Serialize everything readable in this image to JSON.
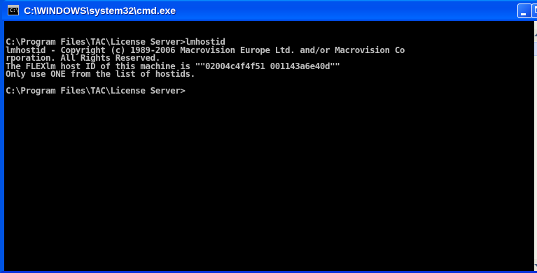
{
  "window": {
    "title": "C:\\WINDOWS\\system32\\cmd.exe",
    "icon": "cmd-console-icon",
    "icon_glyph": "C:\\",
    "accent_color": "#0054e3"
  },
  "console": {
    "background": "#000000",
    "foreground": "#c0c0c0",
    "lines": [
      "C:\\Program Files\\TAC\\License Server>lmhostid",
      "lmhostid - Copyright (c) 1989-2006 Macrovision Europe Ltd. and/or Macrovision Co",
      "rporation. All Rights Reserved.",
      "The FLEXlm host ID of this machine is \"\"02004c4f4f51 001143a6e40d\"\"",
      "Only use ONE from the list of hostids.",
      "",
      "C:\\Program Files\\TAC\\License Server>"
    ]
  }
}
